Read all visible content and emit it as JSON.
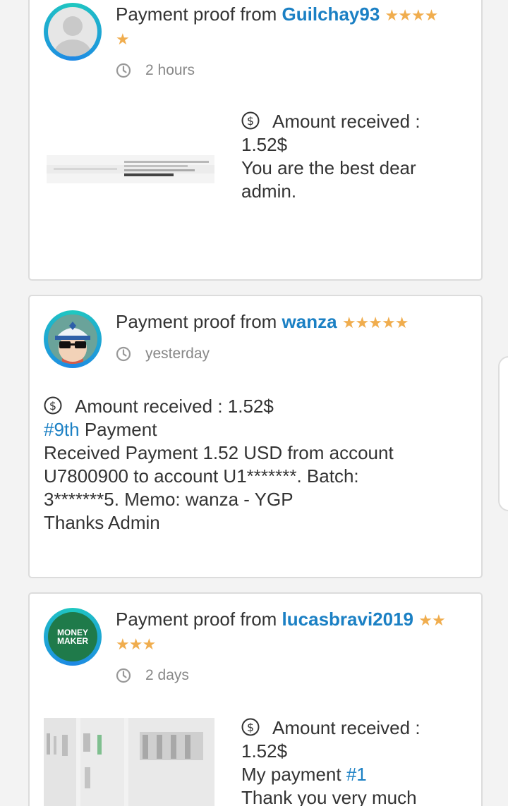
{
  "posts": [
    {
      "title_prefix": "Payment proof from",
      "username": "Guilchay93",
      "rating_stars": 5,
      "stars_line1": "★★★★",
      "stars_line2": "★",
      "time": "2 hours",
      "amount_line1": "Amount received :",
      "amount_line2": "1.52$",
      "message_line1": "You are the best dear",
      "message_line2": "admin.",
      "avatar": "default-user-avatar"
    },
    {
      "title_prefix": "Payment proof from",
      "username": "wanza",
      "rating_stars": 5,
      "stars": "★★★★★",
      "time": "yesterday",
      "amount": "Amount received : 1.52$",
      "payment_link": "#9th",
      "payment_word": "Payment",
      "detail_line1": "Received Payment 1.52 USD from account",
      "detail_line2": "U7800900 to account U1*******. Batch:",
      "detail_line3": "3*******5. Memo: wanza - YGP",
      "detail_line4": "Thanks Admin",
      "avatar": "cartoon-character-avatar"
    },
    {
      "title_prefix": "Payment proof from",
      "username": "lucasbravi2019",
      "rating_stars": 5,
      "stars_line1": "★★",
      "stars_line2": "★★★",
      "time": "2 days",
      "amount_line1": "Amount received :",
      "amount_line2": "1.52$",
      "message_prefix": "My payment",
      "message_link": "#1",
      "message_line2": "Thank you very much",
      "avatar_text_line1": "MONEY",
      "avatar_text_line2": "MAKER"
    }
  ],
  "colors": {
    "username": "#1b80c4",
    "stars": "#f0ad4e",
    "avatar_ring": "#1fc8c0",
    "money_maker_bg": "#1f7a4a"
  }
}
